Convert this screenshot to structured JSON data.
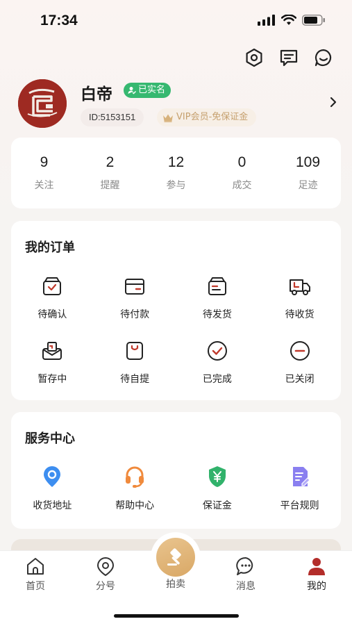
{
  "status_bar": {
    "time": "17:34"
  },
  "profile": {
    "name": "白帝",
    "verified": "已实名",
    "id": "ID:5153151",
    "vip": "VIP会员-免保证金"
  },
  "stats": [
    {
      "value": "9",
      "label": "关注"
    },
    {
      "value": "2",
      "label": "提醒"
    },
    {
      "value": "12",
      "label": "参与"
    },
    {
      "value": "0",
      "label": "成交"
    },
    {
      "value": "109",
      "label": "足迹"
    }
  ],
  "orders": {
    "title": "我的订单",
    "items": [
      {
        "label": "待确认",
        "icon": "box-check-icon"
      },
      {
        "label": "待付款",
        "icon": "wallet-icon"
      },
      {
        "label": "待发货",
        "icon": "package-icon"
      },
      {
        "label": "待收货",
        "icon": "truck-icon"
      },
      {
        "label": "暂存中",
        "icon": "inbox-tray-icon"
      },
      {
        "label": "待自提",
        "icon": "shopping-bag-icon"
      },
      {
        "label": "已完成",
        "icon": "check-circle-icon"
      },
      {
        "label": "已关闭",
        "icon": "minus-circle-icon"
      }
    ]
  },
  "services": {
    "title": "服务中心",
    "items": [
      {
        "label": "收货地址",
        "icon": "location-pin-icon",
        "color": "#3d8ef0"
      },
      {
        "label": "帮助中心",
        "icon": "headset-icon",
        "color": "#f08a3c"
      },
      {
        "label": "保证金",
        "icon": "shield-yen-icon",
        "color": "#31b26b"
      },
      {
        "label": "平台规则",
        "icon": "document-edit-icon",
        "color": "#8a7ff0"
      }
    ]
  },
  "tabbar": {
    "items": [
      {
        "label": "首页",
        "icon": "home-icon"
      },
      {
        "label": "分号",
        "icon": "map-pin-icon"
      },
      {
        "label": "拍卖",
        "icon": "gavel-icon"
      },
      {
        "label": "消息",
        "icon": "chat-bubble-icon"
      },
      {
        "label": "我的",
        "icon": "user-icon"
      }
    ],
    "active": "我的"
  },
  "colors": {
    "verified_green": "#36b870",
    "vip_gold": "#c6a06e",
    "avatar_red": "#9e2a22",
    "auction_gold": "#dfb173",
    "profile_tab_red": "#b32d2a"
  }
}
